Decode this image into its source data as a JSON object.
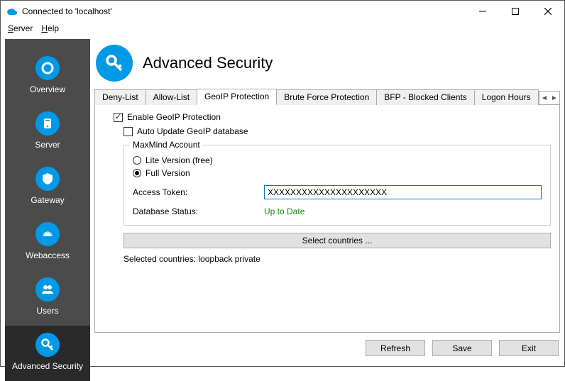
{
  "window": {
    "title": "Connected to 'localhost'"
  },
  "menu": {
    "server": "Server",
    "help": "Help"
  },
  "sidebar": {
    "items": [
      {
        "label": "Overview"
      },
      {
        "label": "Server"
      },
      {
        "label": "Gateway"
      },
      {
        "label": "Webaccess"
      },
      {
        "label": "Users"
      },
      {
        "label": "Advanced Security"
      }
    ]
  },
  "header": {
    "title": "Advanced Security"
  },
  "tabs": [
    {
      "label": "Deny-List"
    },
    {
      "label": "Allow-List"
    },
    {
      "label": "GeoIP Protection"
    },
    {
      "label": "Brute Force Protection"
    },
    {
      "label": "BFP - Blocked Clients"
    },
    {
      "label": "Logon Hours"
    }
  ],
  "geoip": {
    "enable_label": "Enable GeoIP Protection",
    "enable_checked": true,
    "autoupdate_label": "Auto Update GeoIP database",
    "autoupdate_checked": false,
    "fieldset_title": "MaxMind Account",
    "version_lite_label": "Lite Version (free)",
    "version_full_label": "Full Version",
    "version_selected": "full",
    "token_label": "Access Token:",
    "token_value": "XXXXXXXXXXXXXXXXXXXXX",
    "status_label": "Database Status:",
    "status_value": "Up to Date",
    "select_countries_btn": "Select countries ...",
    "selected_countries_label": "Selected countries: loopback private"
  },
  "footer": {
    "refresh": "Refresh",
    "save": "Save",
    "exit": "Exit"
  }
}
